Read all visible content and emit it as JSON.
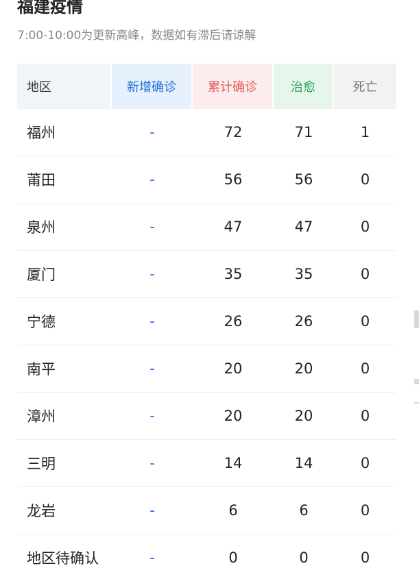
{
  "header": {
    "title": "福建疫情",
    "subtitle": "7:00-10:00为更新高峰，数据如有滞后请谅解"
  },
  "table": {
    "columns": [
      "地区",
      "新增确诊",
      "累计确诊",
      "治愈",
      "死亡"
    ],
    "rows": [
      {
        "region": "福州",
        "new": "-",
        "total": "72",
        "cured": "71",
        "dead": "1"
      },
      {
        "region": "莆田",
        "new": "-",
        "total": "56",
        "cured": "56",
        "dead": "0"
      },
      {
        "region": "泉州",
        "new": "-",
        "total": "47",
        "cured": "47",
        "dead": "0"
      },
      {
        "region": "厦门",
        "new": "-",
        "total": "35",
        "cured": "35",
        "dead": "0"
      },
      {
        "region": "宁德",
        "new": "-",
        "total": "26",
        "cured": "26",
        "dead": "0"
      },
      {
        "region": "南平",
        "new": "-",
        "total": "20",
        "cured": "20",
        "dead": "0"
      },
      {
        "region": "漳州",
        "new": "-",
        "total": "20",
        "cured": "20",
        "dead": "0"
      },
      {
        "region": "三明",
        "new": "-",
        "total": "14",
        "cured": "14",
        "dead": "0"
      },
      {
        "region": "龙岩",
        "new": "-",
        "total": "6",
        "cured": "6",
        "dead": "0"
      },
      {
        "region": "地区待确认",
        "new": "-",
        "total": "0",
        "cured": "0",
        "dead": "0"
      }
    ]
  },
  "colors": {
    "new_confirmed": "#1e6fd9",
    "total_confirmed": "#e35b5b",
    "cured": "#2aa05a",
    "dead": "#777777"
  }
}
